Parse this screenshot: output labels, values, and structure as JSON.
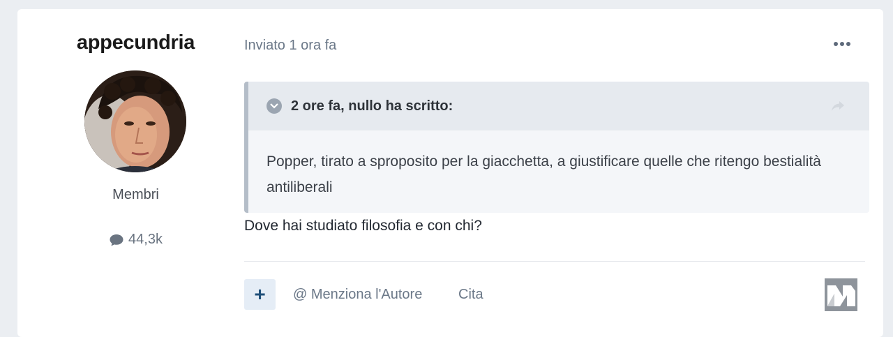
{
  "author": {
    "name": "appecundria",
    "group": "Membri",
    "post_count": "44,3k"
  },
  "post": {
    "meta": "Inviato 1 ora fa",
    "quote": {
      "citation": "2 ore fa, nullo ha scritto:",
      "text": "Popper, tirato a sproposito per la giacchetta, a giustificare quelle che ritengo bestialità antiliberali"
    },
    "body": "Dove hai studiato filosofia e con chi?"
  },
  "actions": {
    "mention_label": "@ Menziona l'Autore",
    "quote_label": "Cita"
  },
  "icons": {
    "more": "more-icon",
    "chevron": "chevron-down-icon",
    "share": "share-icon",
    "comment": "comment-icon",
    "plus": "plus-icon",
    "logo": "brand-logo"
  },
  "colors": {
    "accent": "#1f4f79",
    "muted_text": "#6b7888",
    "quote_border": "#b4bdc8"
  }
}
